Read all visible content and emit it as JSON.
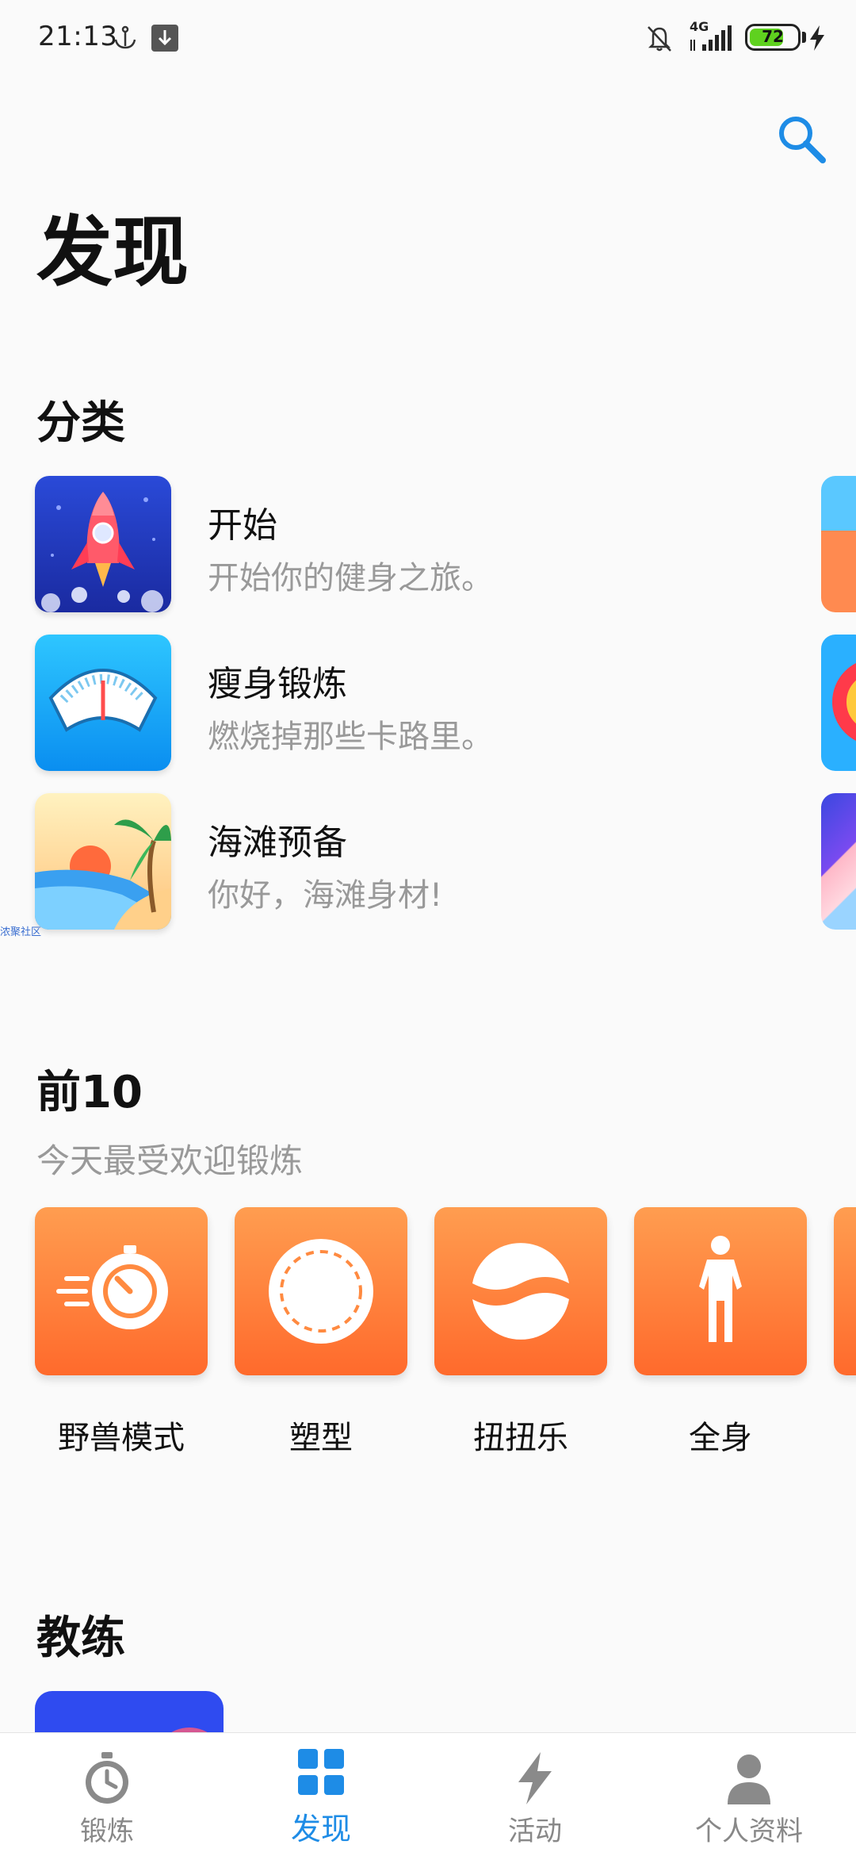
{
  "status_bar": {
    "time": "21:13",
    "network": "4G",
    "battery": "72",
    "battery_level": 0.72
  },
  "page_title": "发现",
  "categories": {
    "title": "分类",
    "items": [
      {
        "title": "开始",
        "description": "开始你的健身之旅。"
      },
      {
        "title": "瘦身锻炼",
        "description": "燃烧掉那些卡路里。"
      },
      {
        "title": "海滩预备",
        "description": "你好，海滩身材!"
      }
    ]
  },
  "top10": {
    "title": "前10",
    "subtitle": "今天最受欢迎锻炼",
    "items": [
      {
        "label": "野兽模式",
        "icon": "stopwatch-speed-icon"
      },
      {
        "label": "塑型",
        "icon": "dashed-circle-icon"
      },
      {
        "label": "扭扭乐",
        "icon": "twist-icon"
      },
      {
        "label": "全身",
        "icon": "full-body-icon"
      }
    ]
  },
  "coaches": {
    "title": "教练"
  },
  "watermark": "浓聚社区",
  "bottom_nav": [
    {
      "label": "锻炼",
      "icon": "stopwatch-icon",
      "active": false
    },
    {
      "label": "发现",
      "icon": "grid-icon",
      "active": true
    },
    {
      "label": "活动",
      "icon": "lightning-icon",
      "active": false
    },
    {
      "label": "个人资料",
      "icon": "person-icon",
      "active": false
    }
  ],
  "colors": {
    "accent": "#1e8ce6",
    "tile_orange": "#ff7a34",
    "inactive_nav": "#888888"
  }
}
